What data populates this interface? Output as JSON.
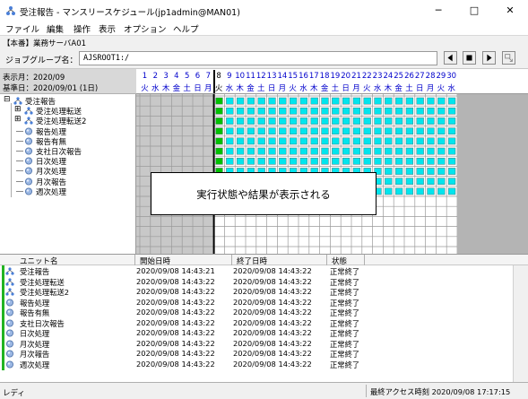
{
  "window": {
    "title": "受注報告 - マンスリースケジュール(jp1admin@MAN01)",
    "minimize_glyph": "─",
    "maximize_glyph": "□",
    "close_glyph": "✕"
  },
  "menu": [
    {
      "label": "ファイル"
    },
    {
      "label": "編集"
    },
    {
      "label": "操作"
    },
    {
      "label": "表示"
    },
    {
      "label": "オプション"
    },
    {
      "label": "ヘルプ"
    }
  ],
  "manager_line": "【本番】業務サーバA01",
  "job_group": {
    "label": "ジョブグループ名：",
    "value": "AJSROOT1:/"
  },
  "nav_icons": [
    "prev-icon",
    "stop-icon",
    "next-icon",
    "refresh-icon"
  ],
  "info": {
    "display_month": "表示月：2020/09",
    "base_date": "基準日：2020/09/01 (1日)"
  },
  "calendar": {
    "days": [
      "1",
      "2",
      "3",
      "4",
      "5",
      "6",
      "7",
      "8",
      "9",
      "10",
      "11",
      "12",
      "13",
      "14",
      "15",
      "16",
      "17",
      "18",
      "19",
      "20",
      "21",
      "22",
      "23",
      "24",
      "25",
      "26",
      "27",
      "28",
      "29",
      "30"
    ],
    "weekdays": [
      "火",
      "水",
      "木",
      "金",
      "土",
      "日",
      "月",
      "火",
      "水",
      "木",
      "金",
      "土",
      "日",
      "月",
      "火",
      "水",
      "木",
      "金",
      "土",
      "日",
      "月",
      "火",
      "水",
      "木",
      "金",
      "土",
      "日",
      "月",
      "火",
      "水"
    ],
    "today_day": "8",
    "done_color": "#00c000",
    "scheduled_color": "#00e5ee"
  },
  "tree": [
    {
      "label": "受注報告",
      "depth": 0,
      "expander": "⊟",
      "icon": "jobnet-icon"
    },
    {
      "label": "受注処理転送",
      "depth": 1,
      "expander": "⊞",
      "icon": "jobnet-icon"
    },
    {
      "label": "受注処理転送2",
      "depth": 1,
      "expander": "⊞",
      "icon": "jobnet-icon"
    },
    {
      "label": "報告処理",
      "depth": 1,
      "expander": "",
      "icon": "job-icon"
    },
    {
      "label": "報告有無",
      "depth": 1,
      "expander": "",
      "icon": "job-icon"
    },
    {
      "label": "支社日次報告",
      "depth": 1,
      "expander": "",
      "icon": "job-icon"
    },
    {
      "label": "日次処理",
      "depth": 1,
      "expander": "",
      "icon": "job-icon"
    },
    {
      "label": "月次処理",
      "depth": 1,
      "expander": "",
      "icon": "job-icon"
    },
    {
      "label": "月次報告",
      "depth": 1,
      "expander": "",
      "icon": "job-icon"
    },
    {
      "label": "週次処理",
      "depth": 1,
      "expander": "",
      "icon": "job-icon"
    }
  ],
  "callout": "実行状態や結果が表示される",
  "list": {
    "headers": [
      "ユニット名",
      "開始日時",
      "終了日時",
      "状態"
    ],
    "rows": [
      {
        "icon": "jobnet-icon",
        "unit": "受注報告",
        "start": "2020/09/08  14:43:21",
        "end": "2020/09/08  14:43:22",
        "status": "正常終了"
      },
      {
        "icon": "jobnet-icon",
        "unit": "受注処理転送",
        "start": "2020/09/08  14:43:22",
        "end": "2020/09/08  14:43:22",
        "status": "正常終了"
      },
      {
        "icon": "jobnet-icon",
        "unit": "受注処理転送2",
        "start": "2020/09/08  14:43:22",
        "end": "2020/09/08  14:43:22",
        "status": "正常終了"
      },
      {
        "icon": "job-icon",
        "unit": "報告処理",
        "start": "2020/09/08  14:43:22",
        "end": "2020/09/08  14:43:22",
        "status": "正常終了"
      },
      {
        "icon": "job-icon",
        "unit": "報告有無",
        "start": "2020/09/08  14:43:22",
        "end": "2020/09/08  14:43:22",
        "status": "正常終了"
      },
      {
        "icon": "job-icon",
        "unit": "支社日次報告",
        "start": "2020/09/08  14:43:22",
        "end": "2020/09/08  14:43:22",
        "status": "正常終了"
      },
      {
        "icon": "job-icon",
        "unit": "日次処理",
        "start": "2020/09/08  14:43:22",
        "end": "2020/09/08  14:43:22",
        "status": "正常終了"
      },
      {
        "icon": "job-icon",
        "unit": "月次処理",
        "start": "2020/09/08  14:43:22",
        "end": "2020/09/08  14:43:22",
        "status": "正常終了"
      },
      {
        "icon": "job-icon",
        "unit": "月次報告",
        "start": "2020/09/08  14:43:22",
        "end": "2020/09/08  14:43:22",
        "status": "正常終了"
      },
      {
        "icon": "job-icon",
        "unit": "週次処理",
        "start": "2020/09/08  14:43:22",
        "end": "2020/09/08  14:43:22",
        "status": "正常終了"
      }
    ]
  },
  "status": {
    "left": "レディ",
    "right": "最終アクセス時刻 2020/09/08 17:17:15"
  }
}
